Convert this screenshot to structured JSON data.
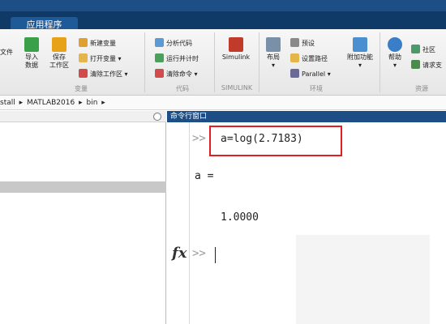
{
  "tabs": {
    "active": "应用程序"
  },
  "ribbon": {
    "file_partial": "文件",
    "import_data": [
      "导入",
      "数据"
    ],
    "save_workspace": [
      "保存",
      "工作区"
    ],
    "new_variable": "新建变量",
    "open_variable": "打开变量 ▾",
    "clear_workspace": "清除工作区 ▾",
    "group_variable": "变量",
    "analyze_code": "分析代码",
    "run_and_time": "运行并计时",
    "clear_commands": "清除命令 ▾",
    "group_code": "代码",
    "simulink": "Simulink",
    "group_simulink": "SIMULINK",
    "layout": "布局",
    "preferences": "预设",
    "set_path": "设置路径",
    "parallel": "Parallel ▾",
    "group_environment": "环境",
    "addons": "附加功能",
    "help": "帮助",
    "community": "社区",
    "request_support": "请求支",
    "group_resources": "资源"
  },
  "address": {
    "parts": [
      "stall",
      "MATLAB2016",
      "bin"
    ],
    "sep": "▸"
  },
  "command_window": {
    "title": "命令行窗口",
    "prompt": ">>",
    "command": "a=log(2.7183)",
    "output_var": "a =",
    "output_value": "1.0000",
    "fx": "fx"
  },
  "colors": {
    "title_blue": "#1d4f86",
    "highlight_red": "#e02020"
  }
}
